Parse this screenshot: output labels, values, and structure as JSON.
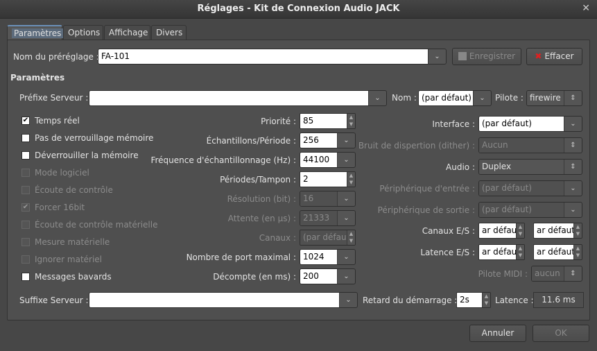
{
  "window": {
    "title": "Réglages - Kit de Connexion Audio JACK",
    "close_icon": "✕"
  },
  "tabs": [
    "Paramètres",
    "Options",
    "Affichage",
    "Divers"
  ],
  "preset": {
    "label": "Nom du préréglage :",
    "value": "FA-101",
    "save": "Enregistrer",
    "clear": "Effacer"
  },
  "section": "Paramètres",
  "server": {
    "prefix_label": "Préfixe Serveur :",
    "prefix_value": "",
    "name_label": "Nom :",
    "name_value": "(par défaut)",
    "driver_label": "Pilote :",
    "driver_value": "firewire",
    "suffix_label": "Suffixe Serveur :",
    "suffix_value": ""
  },
  "checkboxes": [
    {
      "label": "Temps réel",
      "checked": true,
      "enabled": true
    },
    {
      "label": "Pas de verrouillage mémoire",
      "checked": false,
      "enabled": true
    },
    {
      "label": "Déverrouiller la mémoire",
      "checked": false,
      "enabled": true
    },
    {
      "label": "Mode logiciel",
      "checked": false,
      "enabled": false
    },
    {
      "label": "Écoute de contrôle",
      "checked": false,
      "enabled": false
    },
    {
      "label": "Forcer 16bit",
      "checked": true,
      "enabled": false
    },
    {
      "label": "Écoute de contrôle matérielle",
      "checked": false,
      "enabled": false
    },
    {
      "label": "Mesure matérielle",
      "checked": false,
      "enabled": false
    },
    {
      "label": "Ignorer matériel",
      "checked": false,
      "enabled": false
    },
    {
      "label": "Messages bavards",
      "checked": false,
      "enabled": true
    }
  ],
  "middle": [
    {
      "label": "Priorité :",
      "value": "85",
      "kind": "spin",
      "enabled": true
    },
    {
      "label": "Échantillons/Période :",
      "value": "256",
      "kind": "combo",
      "enabled": true
    },
    {
      "label": "Fréquence d'échantillonnage (Hz) :",
      "value": "44100",
      "kind": "combo",
      "enabled": true
    },
    {
      "label": "Périodes/Tampon :",
      "value": "2",
      "kind": "spin",
      "enabled": true
    },
    {
      "label": "Résolution (bit) :",
      "value": "16",
      "kind": "combo",
      "enabled": false
    },
    {
      "label": "Attente (en µs) :",
      "value": "21333",
      "kind": "combo",
      "enabled": false
    },
    {
      "label": "Canaux :",
      "value": "(par défaut)",
      "kind": "spin",
      "enabled": false
    },
    {
      "label": "Nombre de port maximal :",
      "value": "1024",
      "kind": "combo",
      "enabled": true
    },
    {
      "label": "Décompte (en ms) :",
      "value": "200",
      "kind": "combo",
      "enabled": true
    }
  ],
  "right": [
    {
      "label": "Interface :",
      "value": "(par défaut)",
      "enabled": true,
      "editable": true
    },
    {
      "label": "Bruit de dispertion (dither) :",
      "value": "Aucun",
      "enabled": false,
      "editable": false
    },
    {
      "label": "Audio :",
      "value": "Duplex",
      "enabled": true,
      "editable": false
    },
    {
      "label": "Périphérique d'entrée :",
      "value": "(par défaut)",
      "enabled": false,
      "editable": false
    },
    {
      "label": "Périphérique de sortie :",
      "value": "(par défaut)",
      "enabled": false,
      "editable": false
    }
  ],
  "channels": {
    "label": "Canaux E/S :",
    "in": "ar défaut)",
    "out": "ar défaut)"
  },
  "latency_io": {
    "label": "Latence E/S :",
    "in": "ar défaut)",
    "out": "ar défaut)"
  },
  "midi": {
    "label": "Pilote MIDI :",
    "value": "aucun"
  },
  "start_delay": {
    "label": "Retard du démarrage :",
    "value": "2s"
  },
  "latency": {
    "label": "Latence :",
    "value": "11.6 ms"
  },
  "footer": {
    "cancel": "Annuler",
    "ok": "OK"
  }
}
